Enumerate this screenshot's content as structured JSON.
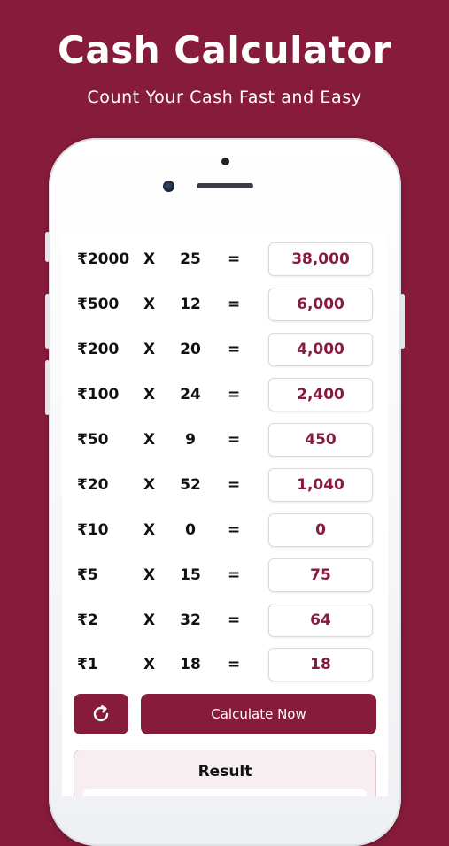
{
  "header": {
    "title": "Cash Calculator",
    "subtitle": "Count Your Cash Fast and Easy"
  },
  "operators": {
    "multiply": "X",
    "equals": "="
  },
  "rows": [
    {
      "note": "₹2000",
      "qty": "25",
      "total": "38,000"
    },
    {
      "note": "₹500",
      "qty": "12",
      "total": "6,000"
    },
    {
      "note": "₹200",
      "qty": "20",
      "total": "4,000"
    },
    {
      "note": "₹100",
      "qty": "24",
      "total": "2,400"
    },
    {
      "note": "₹50",
      "qty": "9",
      "total": "450"
    },
    {
      "note": "₹20",
      "qty": "52",
      "total": "1,040"
    },
    {
      "note": "₹10",
      "qty": "0",
      "total": "0"
    },
    {
      "note": "₹5",
      "qty": "15",
      "total": "75"
    },
    {
      "note": "₹2",
      "qty": "32",
      "total": "64"
    },
    {
      "note": "₹1",
      "qty": "18",
      "total": "18"
    }
  ],
  "actions": {
    "reset_icon": "refresh-icon",
    "calculate_label": "Calculate Now"
  },
  "result": {
    "title": "Result"
  },
  "colors": {
    "brand": "#861b3b",
    "background": "#861b3b",
    "text": "#111111"
  }
}
